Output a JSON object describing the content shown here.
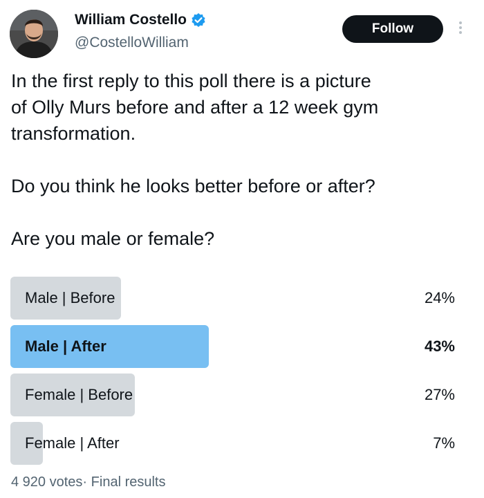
{
  "author": {
    "display_name": "William Costello",
    "handle": "@CostelloWilliam",
    "verified": true,
    "avatar_icon": "profile-photo"
  },
  "actions": {
    "follow_label": "Follow",
    "more_icon": "vertical-ellipsis-icon"
  },
  "tweet": {
    "text": "In the first reply to this poll there is a picture\nof Olly Murs before and after a 12 week gym\ntransformation.\n\nDo you think he looks better before or after?\n\nAre you male or female?"
  },
  "poll": {
    "options": [
      {
        "label": "Male | Before",
        "percent_label": "24%",
        "percent": 24,
        "winner": false
      },
      {
        "label": "Male | After",
        "percent_label": "43%",
        "percent": 43,
        "winner": true
      },
      {
        "label": "Female | Before",
        "percent_label": "27%",
        "percent": 27,
        "winner": false
      },
      {
        "label": "Female | After",
        "percent_label": "7%",
        "percent": 7,
        "winner": false
      }
    ],
    "votes_label": "4 920 votes",
    "separator": "·",
    "status": "Final results"
  },
  "colors": {
    "bar_default": "#d4d9dd",
    "bar_winner": "#78bff2",
    "verified_badge": "#1d9bf0",
    "follow_bg": "#0f1419"
  }
}
